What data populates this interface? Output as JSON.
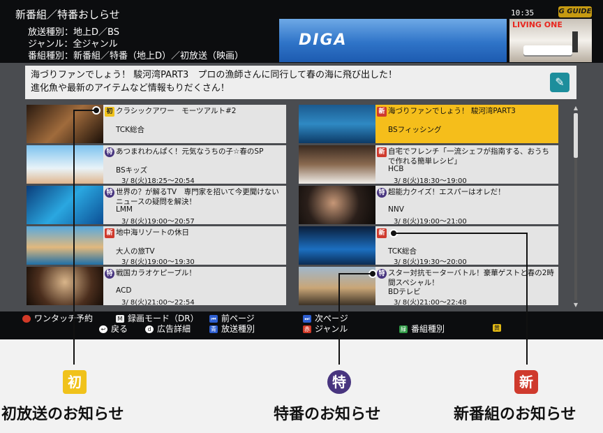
{
  "header": {
    "title": "新番組／特番おしらせ",
    "line1": "放送種別：地上D／BS",
    "line2": "ジャンル：全ジャンル",
    "line3": "番組種別：新番組／特番（地上D）／初放送（映画）",
    "clock": "10:35",
    "logo": "G GUIDE"
  },
  "ads": {
    "diga": "DIGA",
    "living": "LIVING ONE"
  },
  "description": {
    "line1": "海づりファンでしょう！ 駿河湾PART3　プロの漁師さんに同行して春の海に飛び出した！",
    "line2": "進化魚や最新のアイテムなど情報もりだくさん！"
  },
  "programs_left": [
    {
      "badge": "初",
      "title": "クラシックアワー　モーツアルト#2",
      "channel": "TCK総合",
      "time": ""
    },
    {
      "badge": "特",
      "title": "あつまれわんぱく！元気なうちの子☆春のSP",
      "channel": "BSキッズ",
      "time": "3/ 8(火)18:25～20:54"
    },
    {
      "badge": "特",
      "title": "世界の？が解るTV　専門家を招いて今更聞けないニュースの疑問を解決！",
      "channel": "LMM",
      "time": "3/ 8(火)19:00～20:57"
    },
    {
      "badge": "新",
      "title": "地中海リゾートの休日",
      "channel": "大人の旅TV",
      "time": "3/ 8(火)19:00～19:30"
    },
    {
      "badge": "特",
      "title": "戦国カラオケピープル！",
      "channel": "ACD",
      "time": "3/ 8(火)21:00～22:54"
    }
  ],
  "programs_right": [
    {
      "badge": "新",
      "title": "海づりファンでしょう！ 駿河湾PART3",
      "channel": "BSフィッシング",
      "time": ""
    },
    {
      "badge": "新",
      "title": "自宅でフレンチ「一流シェフが指南する、おうちで作れる簡単レシピ」",
      "channel": "HCB",
      "time": "3/ 8(火)18:30～19:00"
    },
    {
      "badge": "特",
      "title": "超能力クイズ！エスパーはオレだ！",
      "channel": "NNV",
      "time": "3/ 8(火)19:00～21:00"
    },
    {
      "badge": "新",
      "title": "",
      "channel": "TCK総合",
      "time": "3/ 8(火)19:30～20:00"
    },
    {
      "badge": "特",
      "title": "スター対抗モーターバトル！豪華ゲストと春の2時間スペシャル！",
      "channel": "BDテレビ",
      "time": "3/ 8(火)21:00～22:48"
    }
  ],
  "footer": {
    "onetouch": "ワンタッチ予約",
    "rec_mode": "録画モード（DR）",
    "prev_page": "前ページ",
    "next_page": "次ページ",
    "back": "戻る",
    "ad_detail": "広告詳細",
    "broadcast_type": "放送種別",
    "genre": "ジャンル",
    "program_type": "番組種別",
    "key_m": "M",
    "key_red": "赤",
    "key_yellow": "黄",
    "key_blue": "青",
    "key_green": "緑"
  },
  "legend": [
    {
      "icon": "初",
      "label": "初放送のお知らせ"
    },
    {
      "icon": "特",
      "label": "特番のお知らせ"
    },
    {
      "icon": "新",
      "label": "新番組のお知らせ"
    }
  ],
  "colors": {
    "highlight": "#f5be1b",
    "new_badge": "#cf3a2d",
    "special_badge": "#48357f",
    "first_badge": "#f0c21b"
  }
}
